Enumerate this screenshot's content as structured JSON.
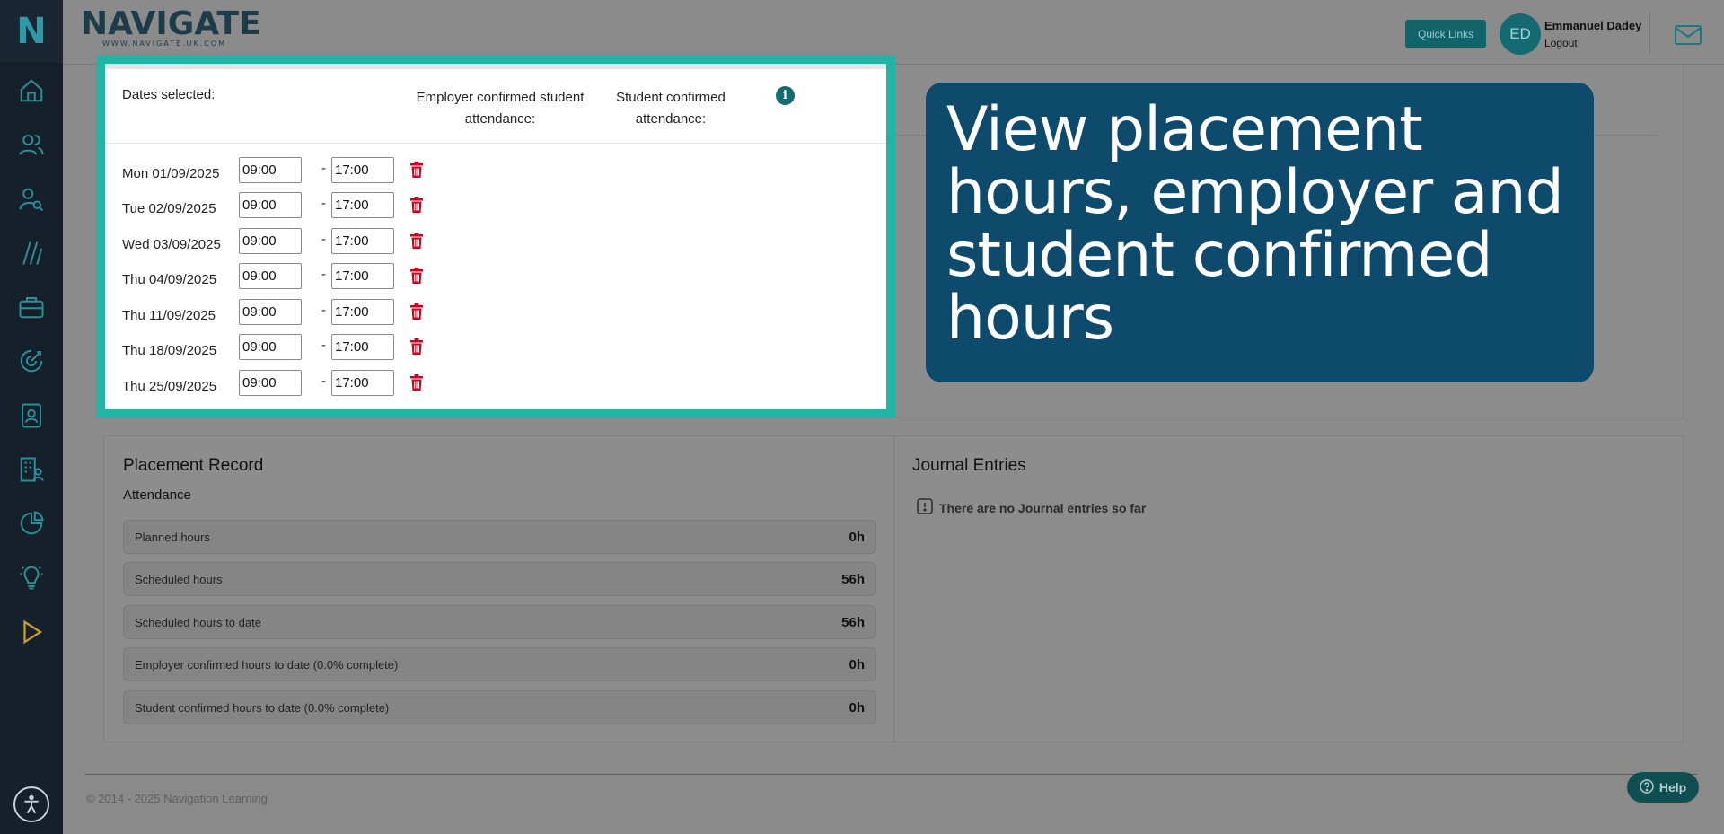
{
  "sidebar": {
    "logo_letter": "N",
    "items": [
      {
        "icon": "home-icon"
      },
      {
        "icon": "users-icon"
      },
      {
        "icon": "user-search-icon"
      },
      {
        "icon": "slashes-icon"
      },
      {
        "icon": "briefcase-icon"
      },
      {
        "icon": "target-icon"
      },
      {
        "icon": "contact-card-icon"
      },
      {
        "icon": "building-user-icon"
      },
      {
        "icon": "pie-chart-icon"
      },
      {
        "icon": "lightbulb-icon"
      },
      {
        "icon": "play-icon"
      }
    ],
    "accessibility_icon": "accessibility-icon"
  },
  "header": {
    "brand_name": "NAVIGATE",
    "brand_url": "WWW.NAVIGATE.UK.COM",
    "quick_links": "Quick Links",
    "avatar_initials": "ED",
    "user_name": "Emmanuel Dadey",
    "logout": "Logout",
    "mail_icon": "mail-icon"
  },
  "schedule": {
    "dates_header": "Dates selected:",
    "employer_header": "Employer confirmed student attendance:",
    "student_header": "Student confirmed attendance:",
    "info_icon": "i",
    "separator": "-",
    "rows": [
      {
        "date": "Mon 01/09/2025",
        "start": "09:00",
        "end": "17:00"
      },
      {
        "date": "Tue 02/09/2025",
        "start": "09:00",
        "end": "17:00"
      },
      {
        "date": "Wed 03/09/2025",
        "start": "09:00",
        "end": "17:00"
      },
      {
        "date": "Thu 04/09/2025",
        "start": "09:00",
        "end": "17:00"
      },
      {
        "date": "Thu 11/09/2025",
        "start": "09:00",
        "end": "17:00"
      },
      {
        "date": "Thu 18/09/2025",
        "start": "09:00",
        "end": "17:00"
      },
      {
        "date": "Thu 25/09/2025",
        "start": "09:00",
        "end": "17:00"
      }
    ]
  },
  "callout": {
    "text": "View placement hours, employer and student confirmed hours"
  },
  "placement_record": {
    "title": "Placement Record",
    "subtitle": "Attendance",
    "stats": [
      {
        "label": "Planned hours",
        "value": "0h"
      },
      {
        "label": "Scheduled hours",
        "value": "56h"
      },
      {
        "label": "Scheduled hours to date",
        "value": "56h"
      },
      {
        "label": "Employer confirmed hours to date (0.0% complete)",
        "value": "0h"
      },
      {
        "label": "Student confirmed hours to date (0.0% complete)",
        "value": "0h"
      }
    ]
  },
  "journal": {
    "title": "Journal Entries",
    "empty_message": "There are no Journal entries so far"
  },
  "footer": {
    "copyright": "© 2014 - 2025 Navigation Learning",
    "help": "Help"
  },
  "colors": {
    "highlight": "#20b5a5",
    "callout_bg": "#0d4a6c",
    "trash_red": "#d0021b",
    "teal_dark": "#166a70"
  }
}
